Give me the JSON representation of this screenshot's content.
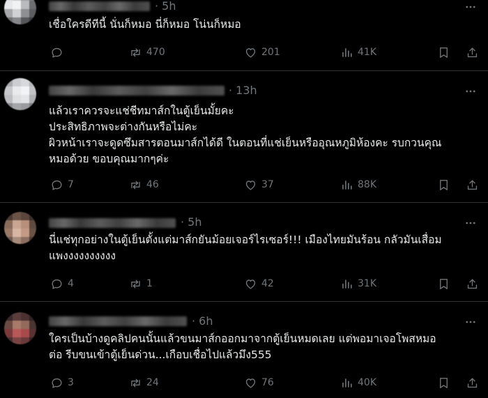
{
  "colors": {
    "background": "#000000",
    "text": "#e7e9ea",
    "muted": "#71767b",
    "divider": "#2f3336"
  },
  "icons": {
    "reply": "speech-bubble-icon",
    "repost": "repost-arrows-icon",
    "like": "heart-icon",
    "views": "bar-chart-icon",
    "bookmark": "bookmark-icon",
    "share": "share-upload-icon",
    "more": "ellipsis-icon"
  },
  "replies": [
    {
      "time": "5h",
      "lines": [
        "เชื่อใครดีทีนี้ นั่นก็หมอ นี่ก็หมอ โน่นก็หมอ"
      ],
      "stats": {
        "replies": "",
        "reposts": "470",
        "likes": "201",
        "views": "41K"
      }
    },
    {
      "time": "13h",
      "lines": [
        "แล้วเราควรจะแช่ชีทมาส์กในตู้เย็นมั้ยคะ",
        "ประสิทธิภาพจะต่างกันหรือไม่คะ",
        "ผิวหน้าเราจะดูดซึมสารตอนมาส์กได้ดี ในตอนที่แช่เย็นหรืออุณหภูมิห้องคะ รบกวนคุณ",
        "หมอด้วย ขอบคุณมากๆค่ะ"
      ],
      "stats": {
        "replies": "7",
        "reposts": "46",
        "likes": "37",
        "views": "88K"
      }
    },
    {
      "time": "5h",
      "lines": [
        "นี่แช่ทุกอย่างในตู้เย็นตั้งแต่มาส์กยันม้อยเจอร์ไรเซอร์!!! เมืองไทยมันร้อน กลัวมันเสื่อม",
        "แพงงงงงงงงงง"
      ],
      "stats": {
        "replies": "4",
        "reposts": "1",
        "likes": "42",
        "views": "31K"
      }
    },
    {
      "time": "6h",
      "lines": [
        "ใครเป็นบ้างดูคลิปคนนั้นแล้วขนมาส์กออกมาจากตู้เย็นหมดเลย แต่พอมาเจอโพสหมอ",
        "ต่อ รีบขนเข้าตู้เย็นด่วน...เกือบเชื่อไปแล้วมึง555"
      ],
      "stats": {
        "replies": "3",
        "reposts": "24",
        "likes": "76",
        "views": "40K"
      }
    }
  ]
}
